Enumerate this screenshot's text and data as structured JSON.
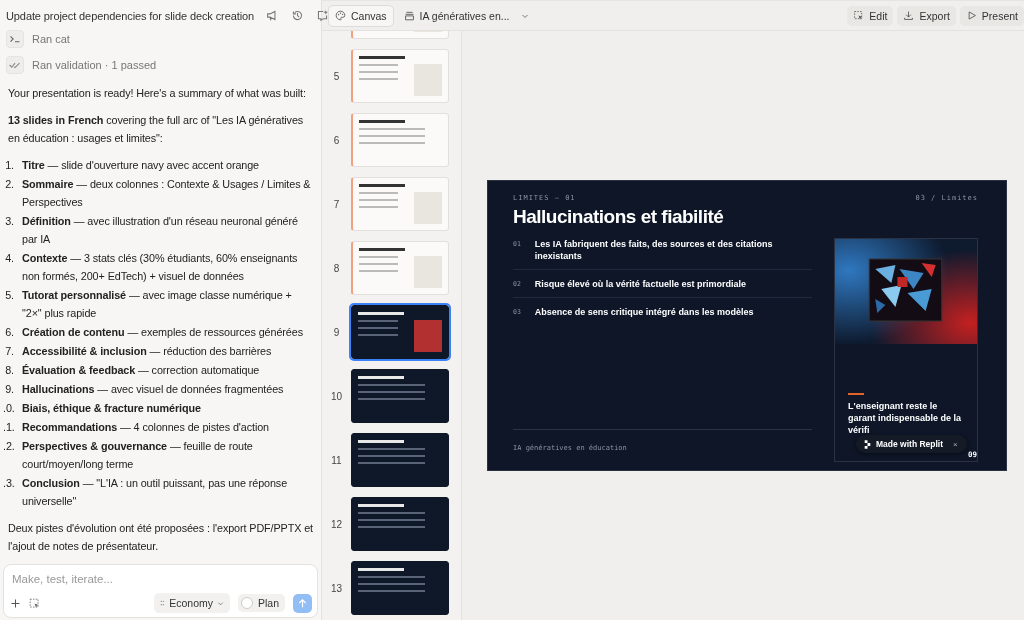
{
  "chat": {
    "title": "Update project dependencies for slide deck creation",
    "steps": [
      {
        "kind": "terminal",
        "label": "Ran cat"
      },
      {
        "kind": "check",
        "label": "Ran validation · 1 passed"
      }
    ],
    "intro": "Your presentation is ready! Here's a summary of what was built:",
    "summary": "**13 slides in French** covering the full arc of \"Les IA génératives en éducation : usages et limites\":",
    "items": [
      {
        "num": "1.",
        "text": "**Titre** — slide d'ouverture navy avec accent orange"
      },
      {
        "num": "2.",
        "text": "**Sommaire** — deux colonnes : Contexte & Usages / Limites & Perspectives"
      },
      {
        "num": "3.",
        "text": "**Définition** — avec illustration d'un réseau neuronal généré par IA"
      },
      {
        "num": "4.",
        "text": "**Contexte** — 3 stats clés (30% étudiants, 60% enseignants non formés, 200+ EdTech) + visuel de données"
      },
      {
        "num": "5.",
        "text": "**Tutorat personnalisé** — avec image classe numérique + \"2×\" plus rapide"
      },
      {
        "num": "6.",
        "text": "**Création de contenu** — exemples de ressources générées"
      },
      {
        "num": "7.",
        "text": "**Accessibilité & inclusion** — réduction des barrières"
      },
      {
        "num": "8.",
        "text": "**Évaluation & feedback** — correction automatique"
      },
      {
        "num": "9.",
        "text": "**Hallucinations** — avec visuel de données fragmentées"
      },
      {
        "num": ".0.",
        "text": "**Biais, éthique & fracture numérique**"
      },
      {
        "num": ".1.",
        "text": "**Recommandations** — 4 colonnes de pistes d'action"
      },
      {
        "num": ".2.",
        "text": "**Perspectives & gouvernance** — feuille de route court/moyen/long terme"
      },
      {
        "num": ".3.",
        "text": "**Conclusion** — \"L'IA : un outil puissant, pas une réponse universelle\""
      }
    ],
    "outro": "Deux pistes d'évolution ont été proposées : l'export PDF/PPTX et l'ajout de notes de présentateur.",
    "input": {
      "placeholder": "Make, test, iterate..."
    },
    "mode": "Economy",
    "plan": {
      "label": "Plan",
      "checked": false
    }
  },
  "toolbar": {
    "canvas": "Canvas",
    "deck": "IA génératives en...",
    "actions": [
      {
        "kind": "edit",
        "label": "Edit"
      },
      {
        "kind": "export",
        "label": "Export"
      },
      {
        "kind": "present",
        "label": "Present"
      }
    ]
  },
  "thumbnails": [
    {
      "dark": false,
      "panel": true,
      "selected": false
    },
    {
      "number": "5",
      "dark": false,
      "panel": true,
      "selected": false
    },
    {
      "number": "6",
      "dark": false,
      "panel": false,
      "selected": false
    },
    {
      "number": "7",
      "dark": false,
      "panel": true,
      "selected": false
    },
    {
      "number": "8",
      "dark": false,
      "panel": true,
      "selected": false
    },
    {
      "number": "9",
      "dark": true,
      "panel": true,
      "selected": true
    },
    {
      "number": "10",
      "dark": true,
      "panel": false,
      "selected": false
    },
    {
      "number": "11",
      "dark": true,
      "panel": false,
      "selected": false
    },
    {
      "number": "12",
      "dark": true,
      "panel": false,
      "selected": false
    },
    {
      "number": "13",
      "dark": true,
      "panel": false,
      "selected": false
    }
  ],
  "slide": {
    "label": "LIMITES — 01",
    "section": "03 / Limites",
    "title": "Hallucinations et fiabilité",
    "points": [
      {
        "num": "01",
        "text": "Les IA fabriquent des faits, des sources et des citations inexistants"
      },
      {
        "num": "02",
        "text": "Risque élevé où la vérité factuelle est primordiale"
      },
      {
        "num": "03",
        "text": "Absence de sens critique intégré dans les modèles"
      }
    ],
    "quote": "L'enseignant reste le garant indispensable de la vérifi",
    "footer": "IA génératives en éducation",
    "page": "09"
  },
  "badge": {
    "label": "Made with Replit",
    "close": "×"
  }
}
